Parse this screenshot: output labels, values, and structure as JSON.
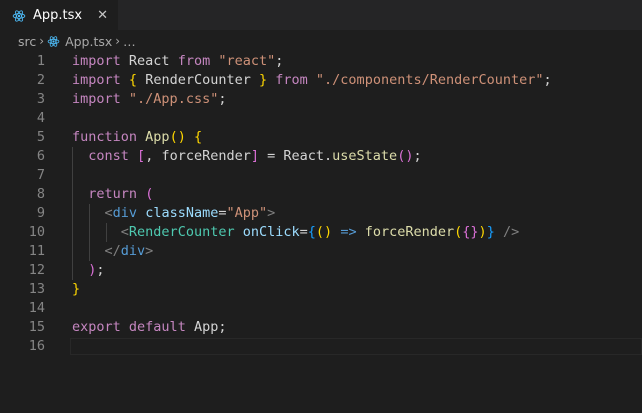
{
  "tab": {
    "filename": "App.tsx",
    "close_glyph": "✕"
  },
  "breadcrumb": {
    "folder": "src",
    "file": "App.tsx",
    "more": "…"
  },
  "colors": {
    "react_icon": "#4fc1ff",
    "editor_bg": "#1e1e1e"
  },
  "lines": [
    {
      "n": "1",
      "t": [
        [
          "kw",
          "import"
        ],
        [
          "pn",
          " React "
        ],
        [
          "kw",
          "from"
        ],
        [
          "pn",
          " "
        ],
        [
          "st",
          "\"react\""
        ],
        [
          "pn",
          ";"
        ]
      ]
    },
    {
      "n": "2",
      "t": [
        [
          "kw",
          "import"
        ],
        [
          "pn",
          " "
        ],
        [
          "br1",
          "{"
        ],
        [
          "pn",
          " RenderCounter "
        ],
        [
          "br1",
          "}"
        ],
        [
          "pn",
          " "
        ],
        [
          "kw",
          "from"
        ],
        [
          "pn",
          " "
        ],
        [
          "st",
          "\"./components/RenderCounter\""
        ],
        [
          "pn",
          ";"
        ]
      ]
    },
    {
      "n": "3",
      "t": [
        [
          "kw",
          "import"
        ],
        [
          "pn",
          " "
        ],
        [
          "st",
          "\"./App.css\""
        ],
        [
          "pn",
          ";"
        ]
      ]
    },
    {
      "n": "4",
      "t": []
    },
    {
      "n": "5",
      "t": [
        [
          "kw",
          "function"
        ],
        [
          "pn",
          " "
        ],
        [
          "fn",
          "App"
        ],
        [
          "br1",
          "()"
        ],
        [
          "pn",
          " "
        ],
        [
          "br1",
          "{"
        ]
      ]
    },
    {
      "n": "6",
      "t": [
        [
          "pn",
          "  "
        ],
        [
          "kw",
          "const"
        ],
        [
          "pn",
          " "
        ],
        [
          "br2",
          "["
        ],
        [
          "pn",
          ", forceRender"
        ],
        [
          "br2",
          "]"
        ],
        [
          "pn",
          " = React."
        ],
        [
          "fn",
          "useState"
        ],
        [
          "br2",
          "()"
        ],
        [
          "pn",
          ";"
        ]
      ]
    },
    {
      "n": "7",
      "t": []
    },
    {
      "n": "8",
      "t": [
        [
          "pn",
          "  "
        ],
        [
          "kw",
          "return"
        ],
        [
          "pn",
          " "
        ],
        [
          "br2",
          "("
        ]
      ]
    },
    {
      "n": "9",
      "t": [
        [
          "pn",
          "    "
        ],
        [
          "gy",
          "<"
        ],
        [
          "tg",
          "div"
        ],
        [
          "pn",
          " "
        ],
        [
          "at",
          "className"
        ],
        [
          "pn",
          "="
        ],
        [
          "st",
          "\"App\""
        ],
        [
          "gy",
          ">"
        ]
      ]
    },
    {
      "n": "10",
      "t": [
        [
          "pn",
          "      "
        ],
        [
          "gy",
          "<"
        ],
        [
          "cp",
          "RenderCounter"
        ],
        [
          "pn",
          " "
        ],
        [
          "at",
          "onClick"
        ],
        [
          "pn",
          "="
        ],
        [
          "br3",
          "{"
        ],
        [
          "br1",
          "()"
        ],
        [
          "pn",
          " "
        ],
        [
          "tg",
          "=>"
        ],
        [
          "pn",
          " "
        ],
        [
          "fn",
          "forceRender"
        ],
        [
          "br1",
          "("
        ],
        [
          "br2",
          "{}"
        ],
        [
          "br1",
          ")"
        ],
        [
          "br3",
          "}"
        ],
        [
          "pn",
          " "
        ],
        [
          "gy",
          "/>"
        ]
      ]
    },
    {
      "n": "11",
      "t": [
        [
          "pn",
          "    "
        ],
        [
          "gy",
          "</"
        ],
        [
          "tg",
          "div"
        ],
        [
          "gy",
          ">"
        ]
      ]
    },
    {
      "n": "12",
      "t": [
        [
          "pn",
          "  "
        ],
        [
          "br2",
          ")"
        ],
        [
          "pn",
          ";"
        ]
      ]
    },
    {
      "n": "13",
      "t": [
        [
          "br1",
          "}"
        ]
      ]
    },
    {
      "n": "14",
      "t": []
    },
    {
      "n": "15",
      "t": [
        [
          "kw",
          "export"
        ],
        [
          "pn",
          " "
        ],
        [
          "kw",
          "default"
        ],
        [
          "pn",
          " App;"
        ]
      ]
    },
    {
      "n": "16",
      "t": []
    }
  ]
}
